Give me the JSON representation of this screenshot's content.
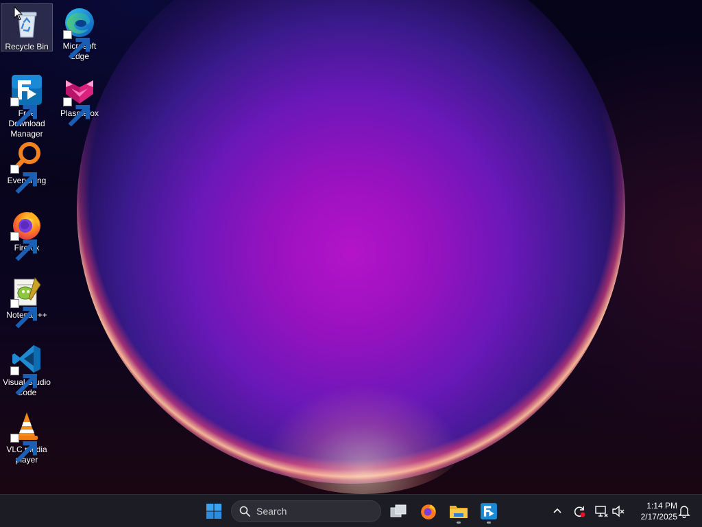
{
  "desktop": {
    "icons": [
      {
        "label": "Recycle Bin"
      },
      {
        "label": "Microsoft Edge"
      },
      {
        "label": "Free Download Manager"
      },
      {
        "label": "Plasmafox"
      },
      {
        "label": "Everything"
      },
      {
        "label": "Firefox"
      },
      {
        "label": "Notepad++"
      },
      {
        "label": "Visual Studio Code"
      },
      {
        "label": "VLC media player"
      }
    ]
  },
  "taskbar": {
    "search_placeholder": "Search",
    "pinned": [
      "start-icon",
      "task-view-icon",
      "firefox-icon",
      "file-explorer-icon",
      "free-download-manager-icon"
    ],
    "tray": [
      "chevron-up-icon",
      "sync-icon",
      "network-icon",
      "volume-muted-icon",
      "notification-icon"
    ],
    "clock": {
      "time": "1:14 PM",
      "date": "2/17/2025"
    }
  },
  "colors": {
    "taskbar_bg": "#1c1c24",
    "accent_blue": "#0078d4",
    "orb_magenta": "#b414c8"
  }
}
